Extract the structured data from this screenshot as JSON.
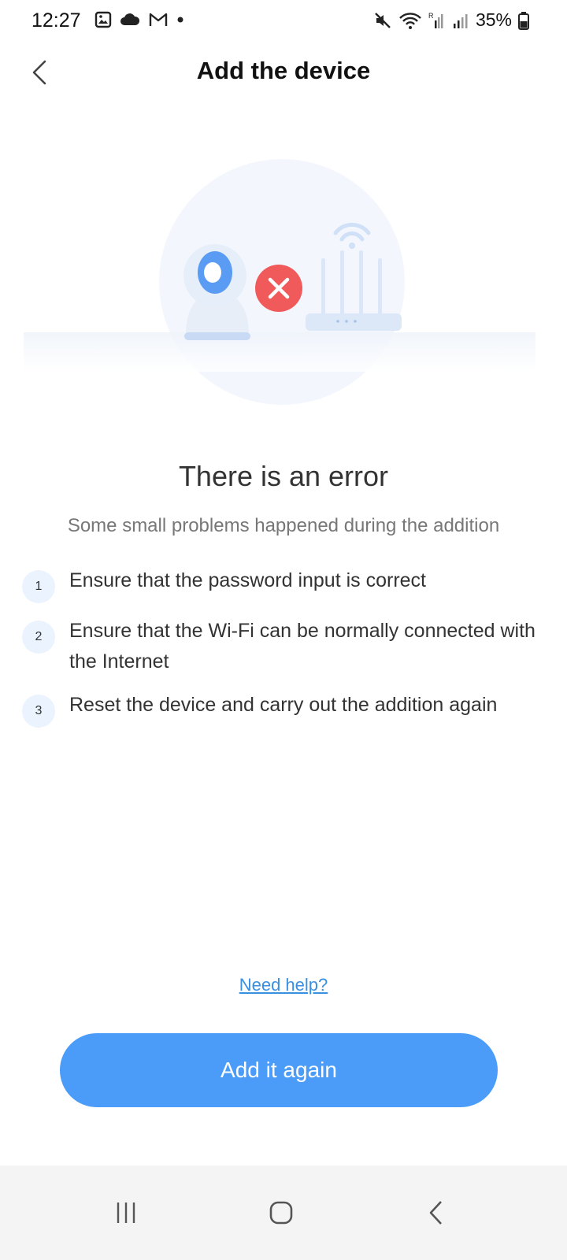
{
  "status_bar": {
    "time": "12:27",
    "battery": "35%",
    "left_icons": [
      "image-icon",
      "cloud-icon",
      "gmail-icon",
      "dot-icon"
    ],
    "right_icons": [
      "mute-icon",
      "wifi-icon",
      "signal-icon",
      "signal-icon",
      "battery-icon"
    ]
  },
  "header": {
    "title": "Add the device",
    "back_icon": "chevron-left-icon"
  },
  "illustration": {
    "icons": [
      "camera-icon",
      "error-x-icon",
      "router-icon",
      "wifi-icon"
    ],
    "error_color": "#f05a5a",
    "accent_color": "#4a9cf8"
  },
  "content": {
    "title": "There is an error",
    "subtitle": "Some small problems happened during the addition",
    "steps": [
      {
        "number": "1",
        "text": "Ensure that the password input is correct"
      },
      {
        "number": "2",
        "text": "Ensure that the Wi-Fi can be normally connected with the Internet"
      },
      {
        "number": "3",
        "text": "Reset the device and carry out the addition again"
      }
    ]
  },
  "actions": {
    "help_link": "Need help?",
    "primary_button": "Add it again"
  },
  "nav_bar": {
    "icons": [
      "recent-apps-icon",
      "home-icon",
      "back-icon"
    ]
  },
  "colors": {
    "primary": "#4a9cf8",
    "link": "#3a90e0",
    "error": "#f05a5a"
  }
}
